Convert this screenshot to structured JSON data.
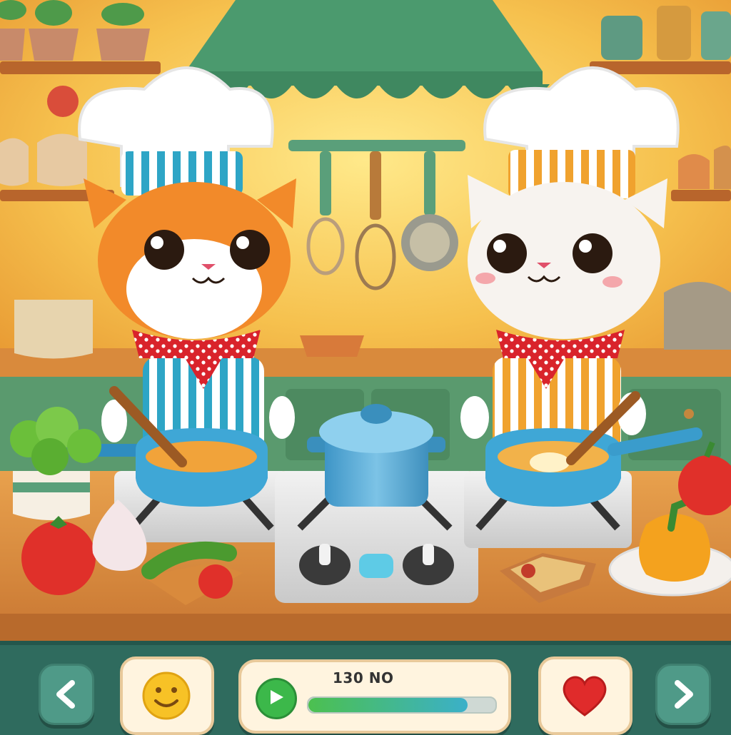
{
  "hud": {
    "prev_icon": "chevron-left-icon",
    "happy_icon": "smiley-face-icon",
    "play_icon": "play-icon",
    "score_text": "130 NO",
    "progress": 0.85,
    "heart_icon": "heart-icon",
    "next_icon": "chevron-right-icon"
  },
  "colors": {
    "wall": "#f6c14e",
    "awning": "#4b9a6e",
    "counter": "#d9893f",
    "cabinet": "#5a9a6e",
    "hud_bg": "#2f6b5e",
    "accent_green": "#3cb84a",
    "heart_red": "#e02b2b"
  }
}
